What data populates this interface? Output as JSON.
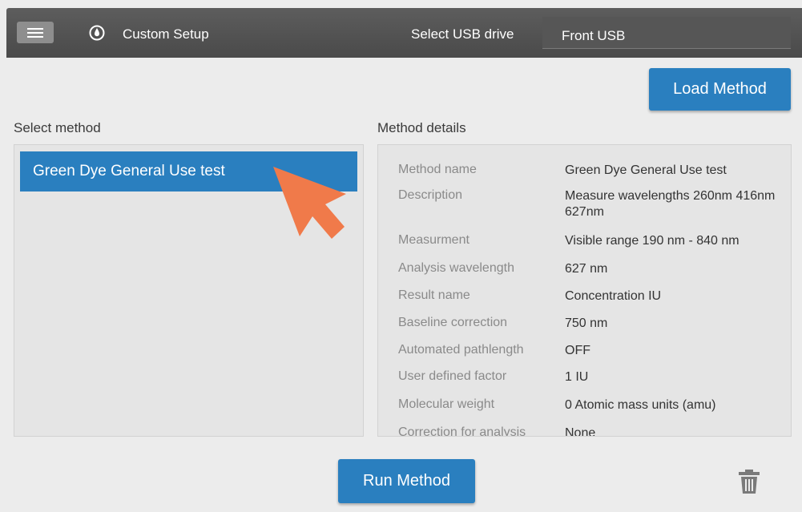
{
  "header": {
    "menu_icon": "hamburger-menu-icon",
    "app_icon": "drop-icon",
    "title": "Custom Setup",
    "usb_label": "Select USB drive",
    "usb_value": "Front USB"
  },
  "actions": {
    "load_method": "Load Method",
    "run_method": "Run Method",
    "delete_icon": "trash-icon"
  },
  "method_list": {
    "label": "Select method",
    "items": [
      "Green Dye General Use test"
    ],
    "selected": "Green Dye General Use test"
  },
  "details": {
    "label": "Method details",
    "rows": [
      {
        "key": "Method name",
        "value": "Green Dye General Use test"
      },
      {
        "key": "Description",
        "value": "Measure wavelengths 260nm 416nm 627nm"
      },
      {
        "key": "Measurment",
        "value": "Visible range 190 nm - 840 nm"
      },
      {
        "key": "Analysis wavelength",
        "value": "627 nm"
      },
      {
        "key": "Result name",
        "value": "Concentration IU"
      },
      {
        "key": "Baseline correction",
        "value": "750 nm"
      },
      {
        "key": "Automated pathlength",
        "value": "OFF"
      },
      {
        "key": "User defined factor",
        "value": "1 IU"
      },
      {
        "key": "Molecular weight",
        "value": "0 Atomic mass units (amu)"
      },
      {
        "key": "Correction for analysis",
        "value": "None"
      }
    ]
  },
  "colors": {
    "accent": "#2a7fbf",
    "topbar": "#4f4f4f",
    "background": "#ececec",
    "pointer": "#f07a4a"
  }
}
